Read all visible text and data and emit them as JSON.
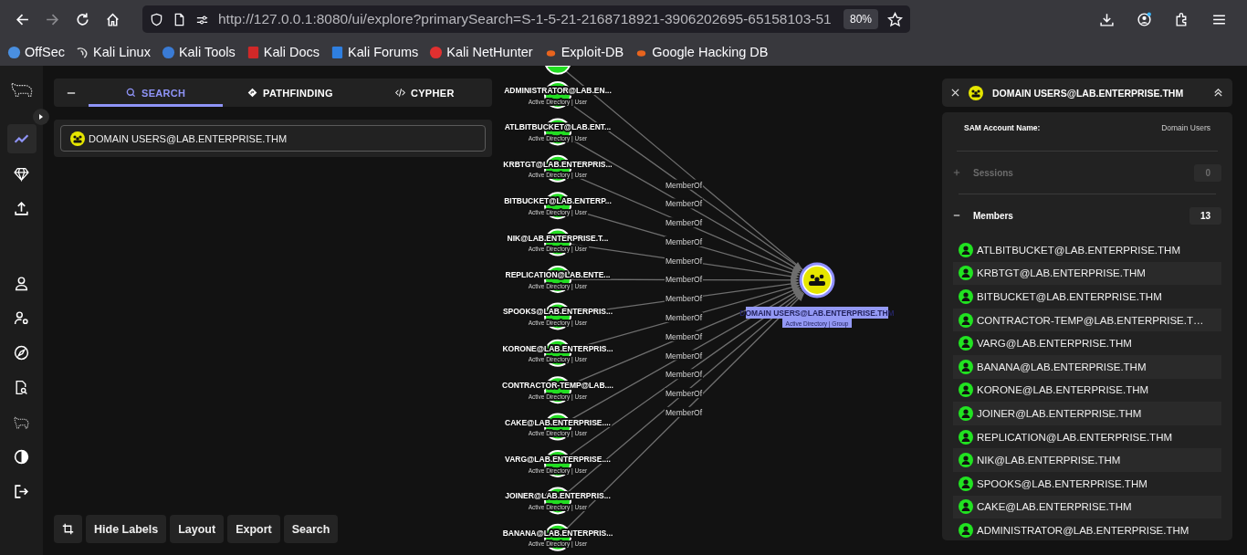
{
  "browser": {
    "url": "http://127.0.0.1:8080/ui/explore?primarySearch=S-1-5-21-2168718921-3906202695-65158103-51",
    "zoom": "80%",
    "bookmarks": [
      {
        "label": "OffSec",
        "kind": "offsec"
      },
      {
        "label": "Kali Linux",
        "kind": "kali"
      },
      {
        "label": "Kali Tools",
        "kind": "tools"
      },
      {
        "label": "Kali Docs",
        "kind": "docs"
      },
      {
        "label": "Kali Forums",
        "kind": "forums"
      },
      {
        "label": "Kali NetHunter",
        "kind": "nethunter"
      },
      {
        "label": "Exploit-DB",
        "kind": "bug"
      },
      {
        "label": "Google Hacking DB",
        "kind": "bug"
      }
    ]
  },
  "sidebar": {
    "items": [
      {
        "kind": "graph",
        "selected": true
      },
      {
        "kind": "gem",
        "selected": false
      },
      {
        "kind": "upload",
        "selected": false
      },
      {
        "kind": "user",
        "selected": false
      },
      {
        "kind": "user-gear",
        "selected": false
      },
      {
        "kind": "compass",
        "selected": false
      },
      {
        "kind": "file-search",
        "selected": false
      },
      {
        "kind": "logo",
        "selected": false
      },
      {
        "kind": "contrast",
        "selected": false
      },
      {
        "kind": "logout",
        "selected": false
      }
    ]
  },
  "search_panel": {
    "tabs": [
      {
        "label": "SEARCH",
        "kind": "search",
        "selected": true
      },
      {
        "label": "PATHFINDING",
        "kind": "route",
        "selected": false
      },
      {
        "label": "CYPHER",
        "kind": "code",
        "selected": false
      }
    ],
    "search_value": "DOMAIN USERS@LAB.ENTERPRISE.THM"
  },
  "graph": {
    "nodes": [
      {
        "name": "ADMINISTRATOR@LAB.EN...",
        "type": "Active Directory | User"
      },
      {
        "name": "ATLBITBUCKET@LAB.ENT...",
        "type": "Active Directory | User"
      },
      {
        "name": "KRBTGT@LAB.ENTERPRIS...",
        "type": "Active Directory | User"
      },
      {
        "name": "BITBUCKET@LAB.ENTERP...",
        "type": "Active Directory | User"
      },
      {
        "name": "NIK@LAB.ENTERPRISE.T...",
        "type": "Active Directory | User"
      },
      {
        "name": "REPLICATION@LAB.ENTE...",
        "type": "Active Directory | User"
      },
      {
        "name": "SPOOKS@LAB.ENTERPRIS...",
        "type": "Active Directory | User"
      },
      {
        "name": "KORONE@LAB.ENTERPRIS...",
        "type": "Active Directory | User"
      },
      {
        "name": "CONTRACTOR-TEMP@LAB....",
        "type": "Active Directory | User"
      },
      {
        "name": "CAKE@LAB.ENTERPRISE....",
        "type": "Active Directory | User"
      },
      {
        "name": "VARG@LAB.ENTERPRISE....",
        "type": "Active Directory | User"
      },
      {
        "name": "JOINER@LAB.ENTERPRIS...",
        "type": "Active Directory | User"
      },
      {
        "name": "BANANA@LAB.ENTERPRIS...",
        "type": "Active Directory | User"
      }
    ],
    "edges": [
      {
        "label": "MemberOf"
      },
      {
        "label": "MemberOf"
      },
      {
        "label": "MemberOf"
      },
      {
        "label": "MemberOf"
      },
      {
        "label": "MemberOf"
      },
      {
        "label": "MemberOf"
      },
      {
        "label": "MemberOf"
      },
      {
        "label": "MemberOf"
      },
      {
        "label": "MemberOf"
      },
      {
        "label": "MemberOf"
      },
      {
        "label": "MemberOf"
      },
      {
        "label": "MemberOf"
      },
      {
        "label": "MemberOf"
      }
    ],
    "target": {
      "name": "DOMAIN USERS@LAB.ENTERPRISE.THM",
      "type": "Active Directory | Group",
      "selected": true
    }
  },
  "toolbar": {
    "buttons": [
      "Hide Labels",
      "Layout",
      "Export",
      "Search"
    ]
  },
  "entity_panel": {
    "title": "DOMAIN USERS@LAB.ENTERPRISE.THM",
    "properties": [
      {
        "label": "SAM Account Name:",
        "value": "Domain Users"
      }
    ],
    "sections": [
      {
        "label": "Sessions",
        "count": "0",
        "expanded": false,
        "disabled": true
      },
      {
        "label": "Members",
        "count": "13",
        "expanded": true,
        "disabled": false,
        "items": [
          "ATLBITBUCKET@LAB.ENTERPRISE.THM",
          "KRBTGT@LAB.ENTERPRISE.THM",
          "BITBUCKET@LAB.ENTERPRISE.THM",
          "CONTRACTOR-TEMP@LAB.ENTERPRISE.T…",
          "VARG@LAB.ENTERPRISE.THM",
          "BANANA@LAB.ENTERPRISE.THM",
          "KORONE@LAB.ENTERPRISE.THM",
          "JOINER@LAB.ENTERPRISE.THM",
          "REPLICATION@LAB.ENTERPRISE.THM",
          "NIK@LAB.ENTERPRISE.THM",
          "SPOOKS@LAB.ENTERPRISE.THM",
          "CAKE@LAB.ENTERPRISE.THM",
          "ADMINISTRATOR@LAB.ENTERPRISE.THM"
        ]
      }
    ]
  }
}
